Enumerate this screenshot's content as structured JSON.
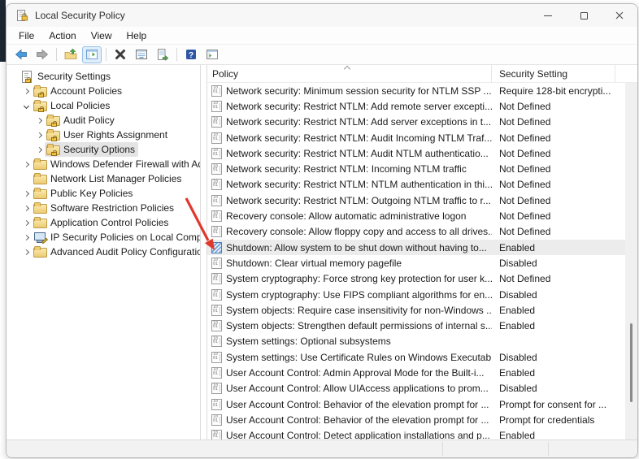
{
  "window": {
    "title": "Local Security Policy",
    "controls": [
      "minimize",
      "maximize",
      "close"
    ]
  },
  "menu": {
    "items": [
      "File",
      "Action",
      "View",
      "Help"
    ]
  },
  "toolbar": {
    "buttons": [
      "back",
      "forward",
      "up-one-level",
      "show-console-tree",
      "delete",
      "properties",
      "export-list",
      "help",
      "new-window"
    ],
    "active_button": "show-console-tree"
  },
  "sidebar": {
    "items": [
      {
        "label": "Security Settings",
        "level": 0,
        "expanded": null,
        "icon": "secpol",
        "selected": false
      },
      {
        "label": "Account Policies",
        "level": 1,
        "expanded": false,
        "icon": "folder-lock",
        "selected": false
      },
      {
        "label": "Local Policies",
        "level": 1,
        "expanded": true,
        "icon": "folder-lock",
        "selected": false
      },
      {
        "label": "Audit Policy",
        "level": 2,
        "expanded": false,
        "icon": "folder-lock",
        "selected": false
      },
      {
        "label": "User Rights Assignment",
        "level": 2,
        "expanded": false,
        "icon": "folder-lock",
        "selected": false
      },
      {
        "label": "Security Options",
        "level": 2,
        "expanded": false,
        "icon": "folder-lock",
        "selected": true
      },
      {
        "label": "Windows Defender Firewall with Adva",
        "level": 1,
        "expanded": false,
        "icon": "folder",
        "selected": false
      },
      {
        "label": "Network List Manager Policies",
        "level": 1,
        "expanded": null,
        "icon": "folder",
        "selected": false
      },
      {
        "label": "Public Key Policies",
        "level": 1,
        "expanded": false,
        "icon": "folder",
        "selected": false
      },
      {
        "label": "Software Restriction Policies",
        "level": 1,
        "expanded": false,
        "icon": "folder",
        "selected": false
      },
      {
        "label": "Application Control Policies",
        "level": 1,
        "expanded": false,
        "icon": "folder",
        "selected": false
      },
      {
        "label": "IP Security Policies on Local Compute",
        "level": 1,
        "expanded": false,
        "icon": "computer",
        "selected": false
      },
      {
        "label": "Advanced Audit Policy Configuration",
        "level": 1,
        "expanded": false,
        "icon": "folder",
        "selected": false
      }
    ]
  },
  "list": {
    "columns": [
      "Policy",
      "Security Setting"
    ],
    "sort": {
      "column": "Policy",
      "direction": "ascending"
    },
    "rows": [
      {
        "policy": "Network security: Minimum session security for NTLM SSP ...",
        "setting": "Require 128-bit encrypti...",
        "selected": false
      },
      {
        "policy": "Network security: Restrict NTLM: Add remote server excepti...",
        "setting": "Not Defined",
        "selected": false
      },
      {
        "policy": "Network security: Restrict NTLM: Add server exceptions in t...",
        "setting": "Not Defined",
        "selected": false
      },
      {
        "policy": "Network security: Restrict NTLM: Audit Incoming NTLM Traf...",
        "setting": "Not Defined",
        "selected": false
      },
      {
        "policy": "Network security: Restrict NTLM: Audit NTLM authenticatio...",
        "setting": "Not Defined",
        "selected": false
      },
      {
        "policy": "Network security: Restrict NTLM: Incoming NTLM traffic",
        "setting": "Not Defined",
        "selected": false
      },
      {
        "policy": "Network security: Restrict NTLM: NTLM authentication in thi...",
        "setting": "Not Defined",
        "selected": false
      },
      {
        "policy": "Network security: Restrict NTLM: Outgoing NTLM traffic to r...",
        "setting": "Not Defined",
        "selected": false
      },
      {
        "policy": "Recovery console: Allow automatic administrative logon",
        "setting": "Not Defined",
        "selected": false
      },
      {
        "policy": "Recovery console: Allow floppy copy and access to all drives...",
        "setting": "Not Defined",
        "selected": false
      },
      {
        "policy": "Shutdown: Allow system to be shut down without having to...",
        "setting": "Enabled",
        "selected": true
      },
      {
        "policy": "Shutdown: Clear virtual memory pagefile",
        "setting": "Disabled",
        "selected": false
      },
      {
        "policy": "System cryptography: Force strong key protection for user k...",
        "setting": "Not Defined",
        "selected": false
      },
      {
        "policy": "System cryptography: Use FIPS compliant algorithms for en...",
        "setting": "Disabled",
        "selected": false
      },
      {
        "policy": "System objects: Require case insensitivity for non-Windows ...",
        "setting": "Enabled",
        "selected": false
      },
      {
        "policy": "System objects: Strengthen default permissions of internal s...",
        "setting": "Enabled",
        "selected": false
      },
      {
        "policy": "System settings: Optional subsystems",
        "setting": "",
        "selected": false
      },
      {
        "policy": "System settings: Use Certificate Rules on Windows Executab...",
        "setting": "Disabled",
        "selected": false
      },
      {
        "policy": "User Account Control: Admin Approval Mode for the Built-i...",
        "setting": "Enabled",
        "selected": false
      },
      {
        "policy": "User Account Control: Allow UIAccess applications to prom...",
        "setting": "Disabled",
        "selected": false
      },
      {
        "policy": "User Account Control: Behavior of the elevation prompt for ...",
        "setting": "Prompt for consent for ...",
        "selected": false
      },
      {
        "policy": "User Account Control: Behavior of the elevation prompt for ...",
        "setting": "Prompt for credentials",
        "selected": false
      },
      {
        "policy": "User Account Control: Detect application installations and p...",
        "setting": "Enabled",
        "selected": false
      }
    ]
  },
  "annotation": {
    "type": "arrow",
    "color": "#e0382c",
    "points_to": "Shutdown: Allow system to be shut down without having to..."
  }
}
